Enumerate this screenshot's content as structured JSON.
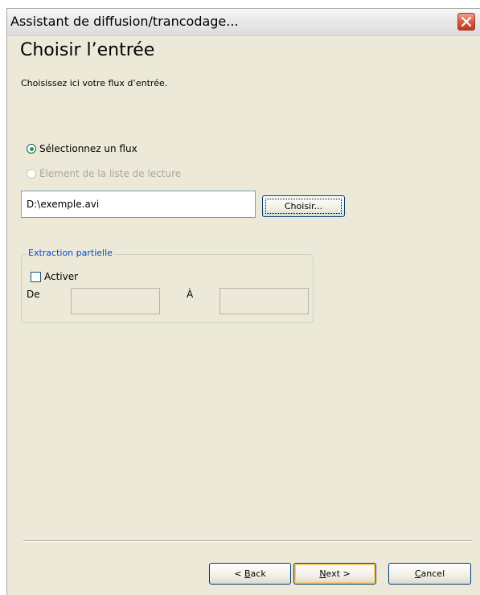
{
  "window": {
    "title": "Assistant de diffusion/trancodage..."
  },
  "page": {
    "title": "Choisir l’entrée",
    "subtitle": "Choisissez ici votre flux d’entrée."
  },
  "source": {
    "option_stream_label": "Sélectionnez un flux",
    "option_stream_selected": true,
    "option_playlist_label": "Élement de la liste de lecture",
    "option_playlist_enabled": false,
    "path_value": "D:\\exemple.avi",
    "choose_button_label": "Choisir..."
  },
  "partial_extraction": {
    "legend": "Extraction partielle",
    "enable_label": "Activer",
    "enable_checked": false,
    "from_label": "De",
    "to_label": "À",
    "from_value": "",
    "to_value": ""
  },
  "footer": {
    "back_prefix": "< ",
    "back_mnemonic": "B",
    "back_rest": "ack",
    "next_mnemonic": "N",
    "next_rest": "ext >",
    "cancel_mnemonic": "C",
    "cancel_rest": "ancel"
  },
  "icons": {
    "close": "close-icon"
  },
  "colors": {
    "window_bg": "#ece9d8",
    "group_legend": "#0046d5",
    "close_button": "#d8563c",
    "radio_dot": "#21a121",
    "input_border": "#7f9db9",
    "button_border": "#003c74"
  }
}
